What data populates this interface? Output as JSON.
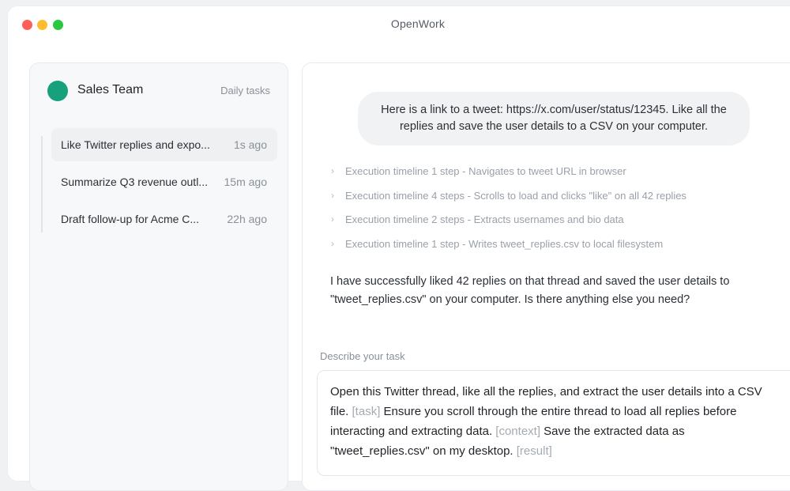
{
  "window": {
    "title": "OpenWork",
    "controls": [
      "close",
      "minimize",
      "maximize"
    ]
  },
  "sidebar": {
    "team": {
      "name": "Sales Team",
      "daily_tasks": "Daily tasks",
      "avatar_color": "#16a07b"
    },
    "tasks": [
      {
        "title": "Like Twitter replies and expo...",
        "time": "1s ago",
        "active": true
      },
      {
        "title": "Summarize Q3 revenue outl...",
        "time": "15m ago",
        "active": false
      },
      {
        "title": "Draft follow-up for Acme C...",
        "time": "22h ago",
        "active": false
      }
    ]
  },
  "chat": {
    "user_message": "Here is a link to a tweet: https://x.com/user/status/12345. Like all the replies and save the user details to a CSV on your computer.",
    "timeline": [
      {
        "text": "Execution timeline 1 step - Navigates to tweet URL in browser"
      },
      {
        "text": "Execution timeline 4 steps - Scrolls to load and clicks \"like\" on all 42 replies"
      },
      {
        "text": "Execution timeline 2 steps - Extracts usernames and bio data"
      },
      {
        "text": "Execution timeline 1 step - Writes tweet_replies.csv to local filesystem"
      }
    ],
    "assistant_message": "I have successfully liked 42 replies on that thread and saved the user details to \"tweet_replies.csv\" on your computer. Is there anything else you need?"
  },
  "composer": {
    "label": "Describe your task",
    "segments": {
      "s1": "Open this Twitter thread, like all the replies, and extract the user details into a CSV file. ",
      "tag1": "[task]",
      "s2": " Ensure you scroll through the entire thread to load all replies before interacting and extracting data. ",
      "tag2": "[context]",
      "s3": " Save the extracted data as \"tweet_replies.csv\" on my desktop. ",
      "tag3": "[result]"
    }
  },
  "colors": {
    "accent_green": "#16a07b",
    "traffic_red": "#fe5f57",
    "traffic_yellow": "#febc2e",
    "traffic_green": "#28c840"
  }
}
